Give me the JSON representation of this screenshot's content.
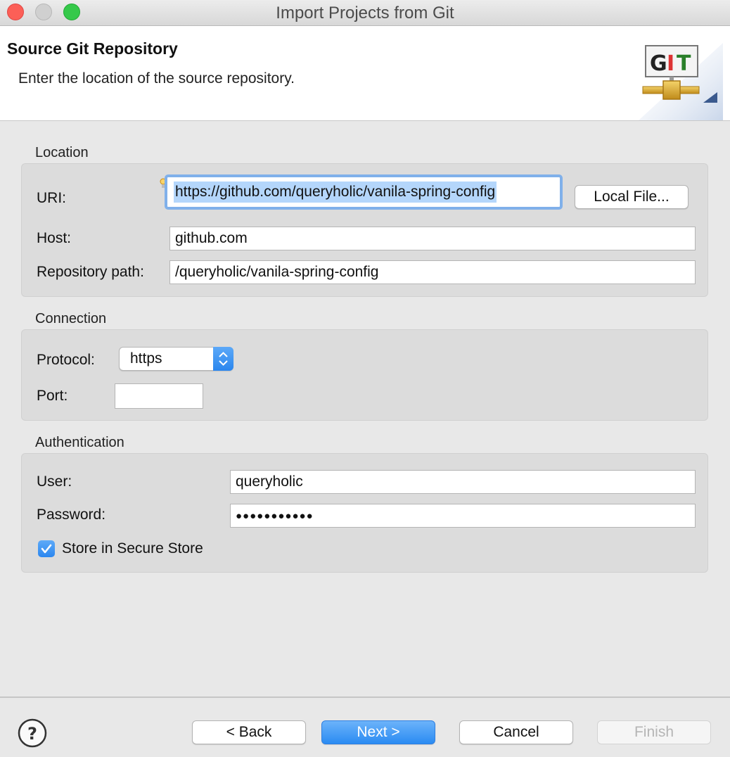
{
  "window": {
    "title": "Import Projects from Git"
  },
  "header": {
    "title": "Source Git Repository",
    "description": "Enter the location of the source repository.",
    "logo_icon": "git-logo-icon",
    "logo_text": "GIT"
  },
  "location": {
    "group_label": "Location",
    "uri_label": "URI:",
    "uri_value": "https://github.com/queryholic/vanila-spring-config",
    "local_file_label": "Local File...",
    "host_label": "Host:",
    "host_value": "github.com",
    "repo_path_label": "Repository path:",
    "repo_path_value": "/queryholic/vanila-spring-config"
  },
  "connection": {
    "group_label": "Connection",
    "protocol_label": "Protocol:",
    "protocol_value": "https",
    "port_label": "Port:",
    "port_value": ""
  },
  "authentication": {
    "group_label": "Authentication",
    "user_label": "User:",
    "user_value": "queryholic",
    "password_label": "Password:",
    "password_masked": "●●●●●●●●●●●",
    "store_label": "Store in Secure Store",
    "store_checked": true
  },
  "footer": {
    "help_icon": "help-icon",
    "back_label": "< Back",
    "next_label": "Next >",
    "cancel_label": "Cancel",
    "finish_label": "Finish"
  },
  "colors": {
    "accent": "#2a8bf2",
    "focus_ring": "#80b0ea",
    "selection": "#b4d6fb"
  }
}
